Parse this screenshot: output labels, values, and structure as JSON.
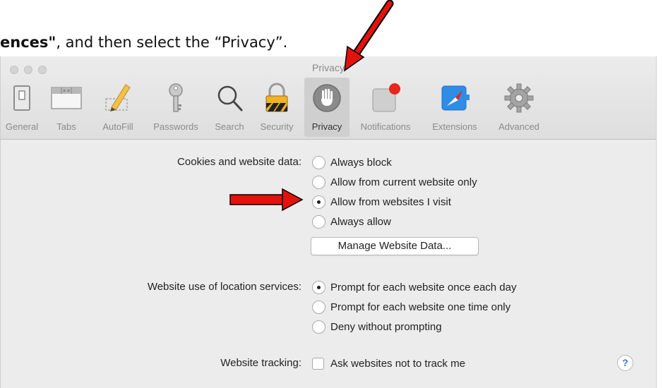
{
  "instruction": {
    "bold_part": "ences\"",
    "rest": ", and then select the “Privacy”."
  },
  "window": {
    "title": "Privacy"
  },
  "toolbar": {
    "items": [
      {
        "label": "General",
        "icon": "switch-icon"
      },
      {
        "label": "Tabs",
        "icon": "tabs-icon"
      },
      {
        "label": "AutoFill",
        "icon": "pencil-icon"
      },
      {
        "label": "Passwords",
        "icon": "key-icon"
      },
      {
        "label": "Search",
        "icon": "magnifier-icon"
      },
      {
        "label": "Security",
        "icon": "padlock-icon"
      },
      {
        "label": "Privacy",
        "icon": "hand-icon"
      },
      {
        "label": "Notifications",
        "icon": "notification-badge-icon"
      },
      {
        "label": "Extensions",
        "icon": "compass-icon"
      },
      {
        "label": "Advanced",
        "icon": "gear-icon"
      }
    ],
    "selected": "Privacy"
  },
  "cookies": {
    "label": "Cookies and website data:",
    "options": [
      "Always block",
      "Allow from current website only",
      "Allow from websites I visit",
      "Always allow"
    ],
    "selected_index": 2,
    "manage_button": "Manage Website Data..."
  },
  "location": {
    "label": "Website use of location services:",
    "options": [
      "Prompt for each website once each day",
      "Prompt for each website one time only",
      "Deny without prompting"
    ],
    "selected_index": 0
  },
  "tracking": {
    "label": "Website tracking:",
    "checkbox_label": "Ask websites not to track me",
    "checked": false
  },
  "help_button": "?",
  "colors": {
    "arrow": "#e3120b",
    "pane": "#ececec",
    "help_accent": "#3a76d6"
  }
}
